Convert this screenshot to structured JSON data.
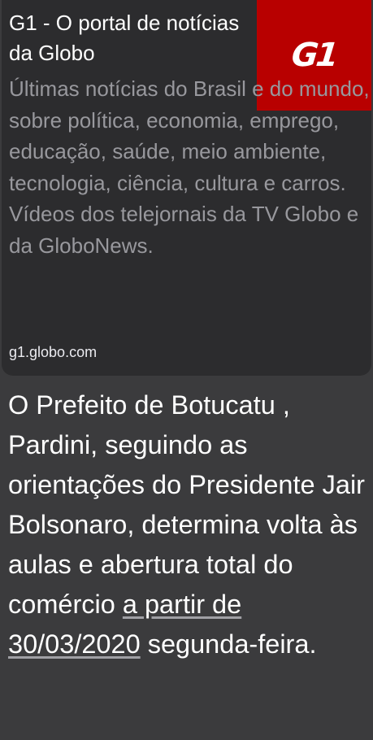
{
  "link_preview": {
    "title": "G1 - O portal de notícias da Globo",
    "description": "Últimas notícias do Brasil e do mundo, sobre política, economia, emprego, educação, saúde, meio ambiente, tecnologia, ciência, cultura e carros. Vídeos dos telejornais da TV Globo e da GloboNews.",
    "url": "g1.globo.com",
    "thumbnail": {
      "logo_text": "G1",
      "background_color": "#b80000",
      "icon": "g1-logo-icon"
    }
  },
  "message": {
    "text_before_link": "O Prefeito de Botucatu , Pardini, seguindo as orientações do Presidente Jair Bolsonaro, determina volta às aulas e abertura total do comércio ",
    "link_text": "a partir de 30/03/2020",
    "text_after_link": " segunda-feira."
  },
  "colors": {
    "background": "#3b3b3d",
    "card_background": "#2c2c2e",
    "title_text": "#ffffff",
    "description_text": "#98989d",
    "thumbnail_red": "#b80000"
  }
}
